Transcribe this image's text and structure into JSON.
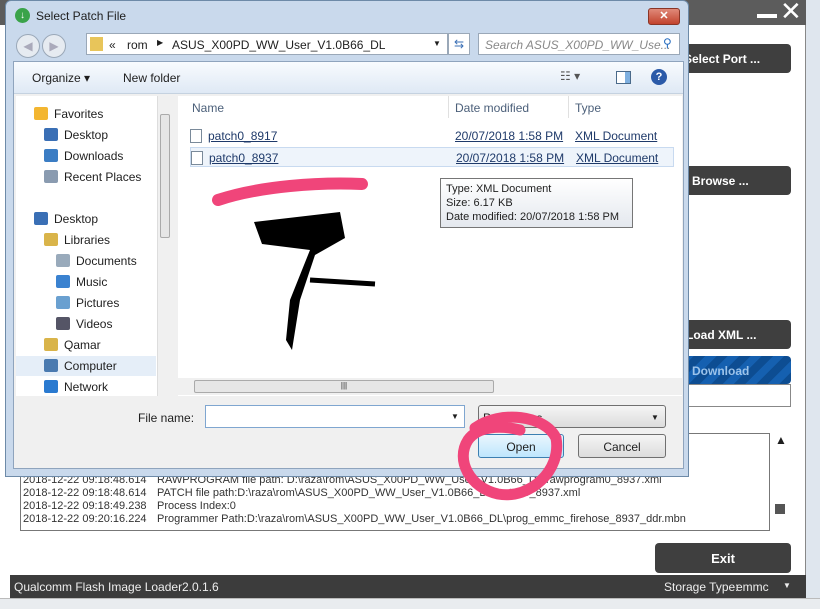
{
  "app": {
    "buttons": {
      "select_port": "Select Port ...",
      "browse": "Browse ...",
      "load_xml": "Load XML ...",
      "download": "Download",
      "exit": "Exit"
    },
    "log": [
      {
        "time": "2018-12-22 09:18:48.614",
        "msg": "RAWPROGRAM file path: D:\\raza\\rom\\ASUS_X00PD_WW_User_V1.0B66_DL\\rawprogram0_8937.xml"
      },
      {
        "time": "2018-12-22 09:18:48.614",
        "msg": "PATCH file path:D:\\raza\\rom\\ASUS_X00PD_WW_User_V1.0B66_DL\\patch0_8937.xml"
      },
      {
        "time": "2018-12-22 09:18:49.238",
        "msg": "Process Index:0"
      },
      {
        "time": "2018-12-22 09:20:16.224",
        "msg": "Programmer Path:D:\\raza\\rom\\ASUS_X00PD_WW_User_V1.0B66_DL\\prog_emmc_firehose_8937_ddr.mbn"
      }
    ],
    "status": {
      "name": "Qualcomm Flash Image Loader",
      "version": "2.0.1.6",
      "storage_label": "Storage Type:",
      "storage_value": "emmc"
    },
    "colors": {
      "dark": "#3f3f3f",
      "download": "#1560b0"
    }
  },
  "dialog": {
    "title": "Select Patch File",
    "breadcrumb": [
      "«",
      "rom",
      "ASUS_X00PD_WW_User_V1.0B66_DL"
    ],
    "search_placeholder": "Search ASUS_X00PD_WW_Use...",
    "toolbar": {
      "organize": "Organize",
      "new_folder": "New folder"
    },
    "nav": [
      {
        "label": "Favorites",
        "icon": "star-icon",
        "indent": 0
      },
      {
        "label": "Desktop",
        "icon": "desktop-icon",
        "indent": 1
      },
      {
        "label": "Downloads",
        "icon": "downloads-icon",
        "indent": 1
      },
      {
        "label": "Recent Places",
        "icon": "recent-icon",
        "indent": 1
      },
      {
        "label": "Desktop",
        "icon": "desktop-icon",
        "indent": 0
      },
      {
        "label": "Libraries",
        "icon": "libraries-icon",
        "indent": 1
      },
      {
        "label": "Documents",
        "icon": "documents-icon",
        "indent": 2
      },
      {
        "label": "Music",
        "icon": "music-icon",
        "indent": 2
      },
      {
        "label": "Pictures",
        "icon": "pictures-icon",
        "indent": 2
      },
      {
        "label": "Videos",
        "icon": "videos-icon",
        "indent": 2
      },
      {
        "label": "Qamar",
        "icon": "user-folder-icon",
        "indent": 1
      },
      {
        "label": "Computer",
        "icon": "computer-icon",
        "indent": 1
      },
      {
        "label": "Network",
        "icon": "network-icon",
        "indent": 1
      }
    ],
    "columns": [
      "Name",
      "Date modified",
      "Type"
    ],
    "files": [
      {
        "name": "patch0_8917",
        "date": "20/07/2018 1:58 PM",
        "type": "XML Document"
      },
      {
        "name": "patch0_8937",
        "date": "20/07/2018 1:58 PM",
        "type": "XML Document"
      }
    ],
    "tooltip": [
      "Type: XML Document",
      "Size: 6.17 KB",
      "Date modified: 20/07/2018 1:58 PM"
    ],
    "file_name_label": "File name:",
    "file_name_value": "",
    "filter": "Patch Files",
    "open": "Open",
    "cancel": "Cancel"
  },
  "annotation": {
    "handwritten": "7",
    "color": "#f0457a"
  }
}
